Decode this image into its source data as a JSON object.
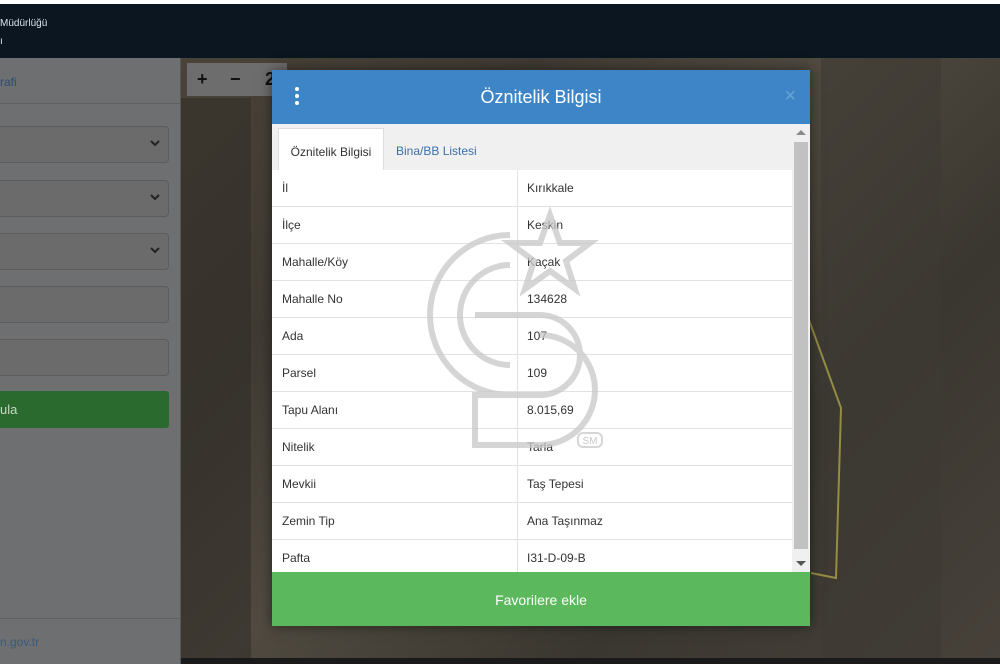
{
  "topbar": {
    "line1": "Müdürlüğü",
    "line2": "ı"
  },
  "sidebar": {
    "tab_label": "rafi",
    "button_label": "ula",
    "footer_link": "n.gov.tr"
  },
  "map_controls": {
    "zoom_in": "+",
    "zoom_out": "−",
    "extra": "2"
  },
  "modal": {
    "title": "Öznitelik Bilgisi",
    "tabs": [
      "Öznitelik Bilgisi",
      "Bina/BB Listesi"
    ],
    "rows": [
      {
        "key": "İl",
        "value": "Kırıkkale"
      },
      {
        "key": "İlçe",
        "value": "Keskin"
      },
      {
        "key": "Mahalle/Köy",
        "value": "Kaçak"
      },
      {
        "key": "Mahalle No",
        "value": "134628"
      },
      {
        "key": "Ada",
        "value": "107"
      },
      {
        "key": "Parsel",
        "value": "109"
      },
      {
        "key": "Tapu Alanı",
        "value": "8.015,69"
      },
      {
        "key": "Nitelik",
        "value": "Tarla"
      },
      {
        "key": "Mevkii",
        "value": "Taş Tepesi"
      },
      {
        "key": "Zemin Tip",
        "value": "Ana Taşınmaz"
      },
      {
        "key": "Pafta",
        "value": "I31-D-09-B"
      }
    ],
    "favorite_button": "Favorilere ekle",
    "close_symbol": "×"
  },
  "watermark": {
    "badge": "SM"
  },
  "colors": {
    "header": "#3d85c6",
    "favorite": "#5cb85c",
    "topbar": "#0b1621"
  }
}
